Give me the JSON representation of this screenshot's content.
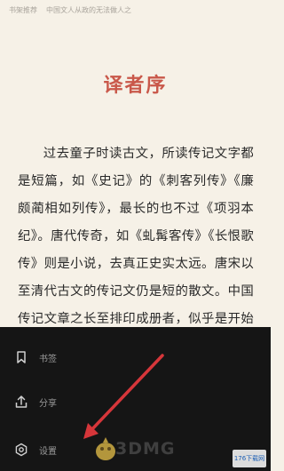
{
  "header": {
    "book_title": "书架推荐",
    "chapter_path": "中国文人从政的无法做人之"
  },
  "chapter": {
    "title": "译者序"
  },
  "body": {
    "paragraph": "过去童子时读古文，所读传记文字都是短篇，如《史记》的《刺客列传》《廉颇蔺相如列传》，最长的也不过《项羽本纪》。唐代传奇，如《虬髯客传》《长恨歌传》则是小说，去真正史实太远。唐宋以至清代古文的传记文仍是短的散文。中国传记文章之长至排印成册者，似乎是开始于现代"
  },
  "menu": {
    "bookmark_label": "书签",
    "share_label": "分享",
    "settings_label": "设置"
  },
  "watermark": {
    "text": "3DMG",
    "site": "176下载网"
  },
  "colors": {
    "page_bg": "#f6f1e7",
    "title": "#c9584a",
    "panel_bg": "#151515",
    "arrow": "#d6363a"
  }
}
